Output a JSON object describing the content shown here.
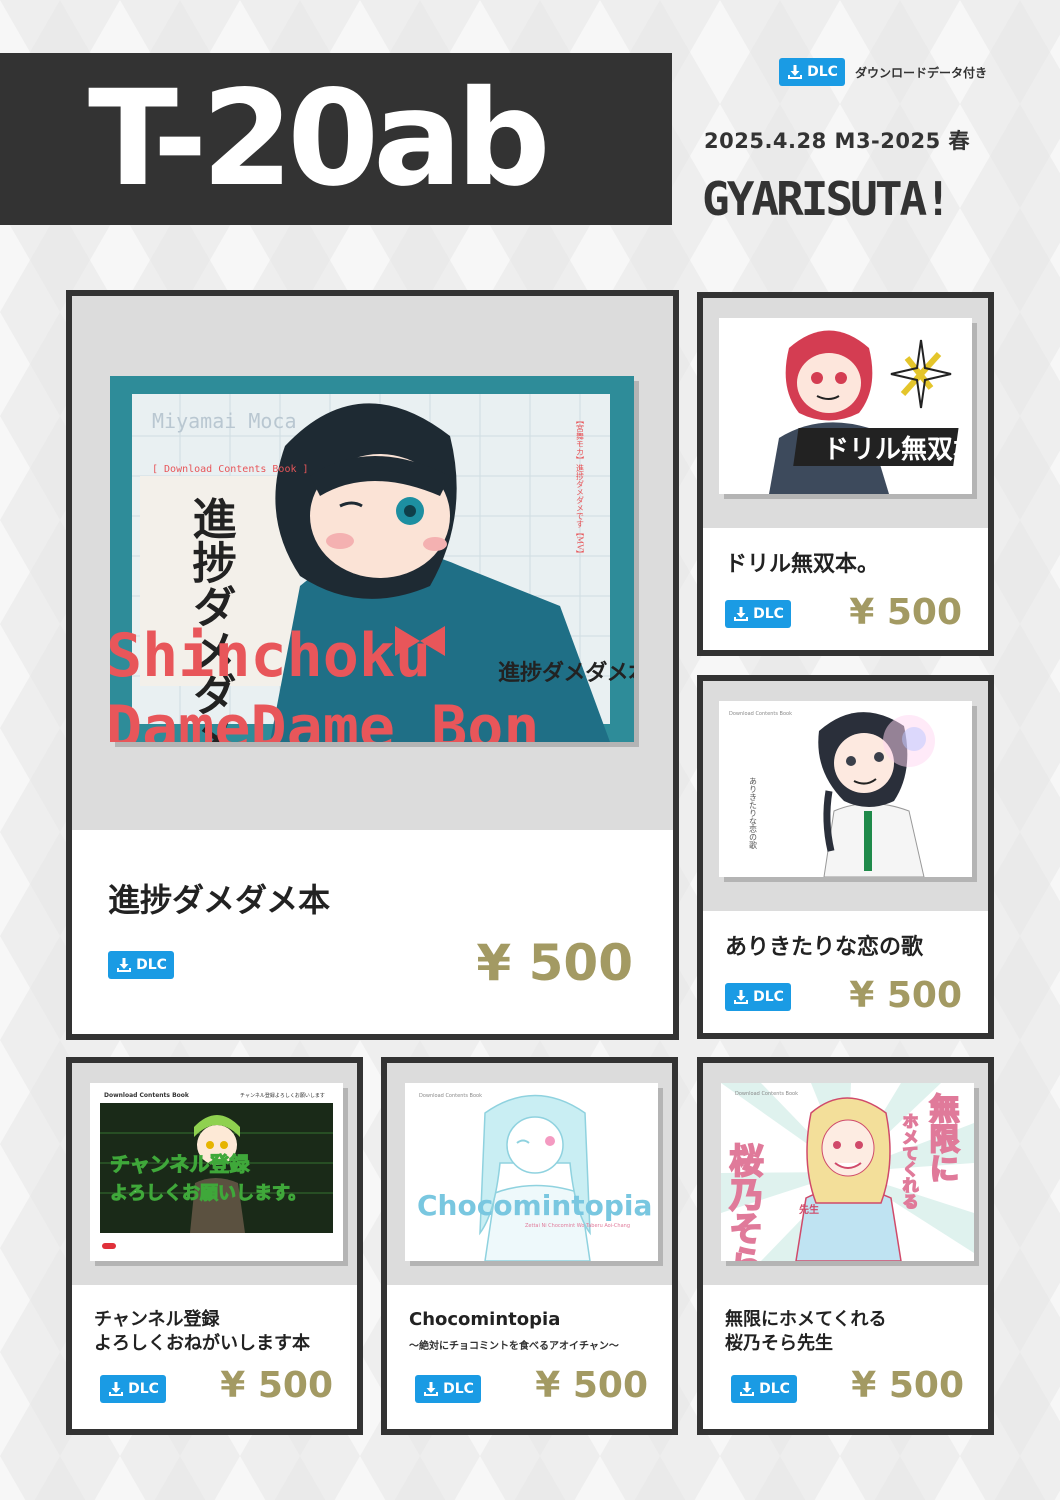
{
  "header": {
    "title": "T-20ab",
    "event_date": "2025.4.28 M3-2025 春",
    "circle_name": "GYARISUTA!",
    "dlc_legend": {
      "badge": "DLC",
      "text": "ダウンロードデータ付き",
      "icon": "download-icon"
    }
  },
  "colors": {
    "accent_blue": "#1a9be4",
    "price_gold": "#a39a63",
    "dark": "#333333",
    "cover_red": "#e8565a",
    "cover_teal": "#2e8c99"
  },
  "main_item": {
    "name": "進捗ダメダメ本",
    "badge": "DLC",
    "price": "¥ 500",
    "cover": {
      "author": "Miyamai Moca",
      "tag": "[ Download Contents Book ]",
      "title_jp": "進捗ダメダメ本",
      "title_en_1": "Shinchoku",
      "title_en_2": "DameDame Bon",
      "logo": "進捗ダメダメ本",
      "side_text": "【宮舞モカ】進捗ダメダメです【MV】"
    }
  },
  "items": [
    {
      "name": "ドリル無双本。",
      "badge": "DLC",
      "price": "¥ 500",
      "cover": {
        "logo": "ドリル無双本。"
      }
    },
    {
      "name": "ありきたりな恋の歌",
      "badge": "DLC",
      "price": "¥ 500",
      "cover": {
        "tag": "Download Contents Book",
        "title": "ありきたりな恋の歌"
      }
    },
    {
      "name_line1": "チャンネル登録",
      "name_line2": "よろしくおねがいします本",
      "badge": "DLC",
      "price": "¥ 500",
      "cover": {
        "tag": "Download Contents Book",
        "top_right": "チャンネル登録よろしくお願いします",
        "line1": "チャンネル登録",
        "line2": "よろしくお願いします。"
      }
    },
    {
      "name": "Chocomintopia",
      "subtitle": "〜絶対にチョコミントを食べるアオイチャン〜",
      "badge": "DLC",
      "price": "¥ 500",
      "cover": {
        "tag": "Download Contents Book",
        "title": "Chocomintopia",
        "caption": "Zettai Ni Chocomint Wo Taberu Aoi-Chang"
      }
    },
    {
      "name_line1": "無限にホメてくれる",
      "name_line2": "桜乃そら先生",
      "badge": "DLC",
      "price": "¥ 500",
      "cover": {
        "tag": "Download Contents Book",
        "left": "桜乃そら",
        "left_small": "先生",
        "right": "無限に",
        "right2": "ホメてくれる"
      }
    }
  ]
}
